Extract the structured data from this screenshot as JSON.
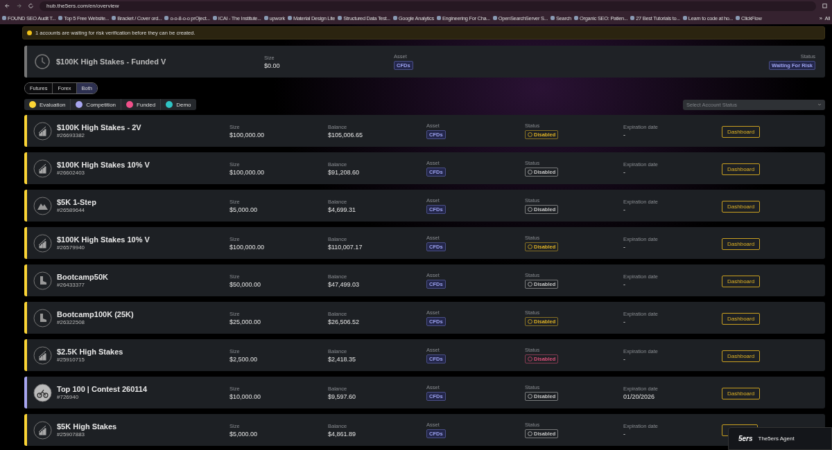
{
  "browser": {
    "url": "hub.the5ers.com/en/overview",
    "bookmarks": [
      "FOUND SEO Audit T...",
      "Top 5 Free Website...",
      "Bracket / Cover ord...",
      "o-o-8-o-o prOject...",
      "ICAI - The Institute...",
      "upwork",
      "Material Design Lite",
      "Structured Data Test...",
      "Google Analytics",
      "Engineering For Cha...",
      "OpenSearchServer S...",
      "Search",
      "Organic SEO: Patien...",
      "27 Best Tutorials to...",
      "Learn to code at ho...",
      "ClickFlow"
    ],
    "more": "»",
    "folder": "All"
  },
  "banner": {
    "text": "1 accounts are waiting for risk verification before they can be created."
  },
  "pending": {
    "title": "$100K High Stakes - Funded V",
    "size_label": "Size",
    "size": "$0.00",
    "asset_label": "Asset",
    "asset": "CFDs",
    "status_label": "Status",
    "status": "Waiting For Risk"
  },
  "markets": [
    {
      "label": "Futures",
      "selected": false
    },
    {
      "label": "Forex",
      "selected": false
    },
    {
      "label": "Both",
      "selected": true
    }
  ],
  "legend": [
    {
      "label": "Evaluation",
      "color": "#fcd535"
    },
    {
      "label": "Competition",
      "color": "#a8a6f0"
    },
    {
      "label": "Funded",
      "color": "#f0508a"
    },
    {
      "label": "Demo",
      "color": "#2fc4c4"
    }
  ],
  "status_filter": {
    "placeholder": "Select Account Status"
  },
  "accounts": [
    {
      "kind": "chart",
      "name": "$100K High Stakes - 2V",
      "id": "#26693382",
      "color": "#fcd535",
      "size_label": "Size",
      "size": "$100,000.00",
      "balance_label": "Balance",
      "balance": "$105,006.65",
      "asset_label": "Asset",
      "asset": "CFDs",
      "status_label": "Status",
      "status": {
        "text": "Disabled",
        "kind": "warning"
      },
      "expiration_label": "Expiration date",
      "expiration": "-",
      "action": "Dashboard"
    },
    {
      "kind": "chart",
      "name": "$100K High Stakes 10% V",
      "id": "#26602403",
      "color": "#fcd535",
      "size_label": "Size",
      "size": "$100,000.00",
      "balance_label": "Balance",
      "balance": "$91,208.60",
      "asset_label": "Asset",
      "asset": "CFDs",
      "status_label": "Status",
      "status": {
        "text": "Disabled",
        "kind": "neutral"
      },
      "expiration_label": "Expiration date",
      "expiration": "-",
      "action": "Dashboard"
    },
    {
      "kind": "mountain",
      "name": "$5K 1-Step",
      "id": "#26589644",
      "color": "#fcd535",
      "size_label": "Size",
      "size": "$5,000.00",
      "balance_label": "Balance",
      "balance": "$4,699.31",
      "asset_label": "Asset",
      "asset": "CFDs",
      "status_label": "Status",
      "status": {
        "text": "Disabled",
        "kind": "neutral"
      },
      "expiration_label": "Expiration date",
      "expiration": "-",
      "action": "Dashboard"
    },
    {
      "kind": "chart",
      "name": "$100K High Stakes 10% V",
      "id": "#26579940",
      "color": "#fcd535",
      "size_label": "Size",
      "size": "$100,000.00",
      "balance_label": "Balance",
      "balance": "$110,007.17",
      "asset_label": "Asset",
      "asset": "CFDs",
      "status_label": "Status",
      "status": {
        "text": "Disabled",
        "kind": "warning"
      },
      "expiration_label": "Expiration date",
      "expiration": "-",
      "action": "Dashboard"
    },
    {
      "kind": "boot",
      "name": "Bootcamp50K",
      "id": "#26433377",
      "color": "#fcd535",
      "size_label": "Size",
      "size": "$50,000.00",
      "balance_label": "Balance",
      "balance": "$47,499.03",
      "asset_label": "Asset",
      "asset": "CFDs",
      "status_label": "Status",
      "status": {
        "text": "Disabled",
        "kind": "neutral"
      },
      "expiration_label": "Expiration date",
      "expiration": "-",
      "action": "Dashboard"
    },
    {
      "kind": "boot",
      "name": "Bootcamp100K (25K)",
      "id": "#26322508",
      "color": "#fcd535",
      "size_label": "Size",
      "size": "$25,000.00",
      "balance_label": "Balance",
      "balance": "$26,506.52",
      "asset_label": "Asset",
      "asset": "CFDs",
      "status_label": "Status",
      "status": {
        "text": "Disabled",
        "kind": "warning"
      },
      "expiration_label": "Expiration date",
      "expiration": "-",
      "action": "Dashboard"
    },
    {
      "kind": "chart",
      "name": "$2.5K High Stakes",
      "id": "#25910715",
      "color": "#fcd535",
      "size_label": "Size",
      "size": "$2,500.00",
      "balance_label": "Balance",
      "balance": "$2,418.35",
      "asset_label": "Asset",
      "asset": "CFDs",
      "status_label": "Status",
      "status": {
        "text": "Disabled",
        "kind": "danger"
      },
      "expiration_label": "Expiration date",
      "expiration": "-",
      "action": "Dashboard"
    },
    {
      "kind": "cyclist",
      "name": "Top 100 | Contest 260114",
      "id": "#726940",
      "color": "#a8a6f0",
      "size_label": "Size",
      "size": "$10,000.00",
      "balance_label": "Balance",
      "balance": "$9,597.60",
      "asset_label": "Asset",
      "asset": "CFDs",
      "status_label": "Status",
      "status": {
        "text": "Disabled",
        "kind": "neutral"
      },
      "expiration_label": "Expiration date",
      "expiration": "01/20/2026",
      "action": "Dashboard"
    },
    {
      "kind": "chart",
      "name": "$5K High Stakes",
      "id": "#25907883",
      "color": "#fcd535",
      "size_label": "Size",
      "size": "$5,000.00",
      "balance_label": "Balance",
      "balance": "$4,861.89",
      "asset_label": "Asset",
      "asset": "CFDs",
      "status_label": "Status",
      "status": {
        "text": "Disabled",
        "kind": "neutral"
      },
      "expiration_label": "Expiration date",
      "expiration": "-"
    }
  ],
  "chat": {
    "logo": "5ers",
    "label": "The5ers Agent"
  }
}
